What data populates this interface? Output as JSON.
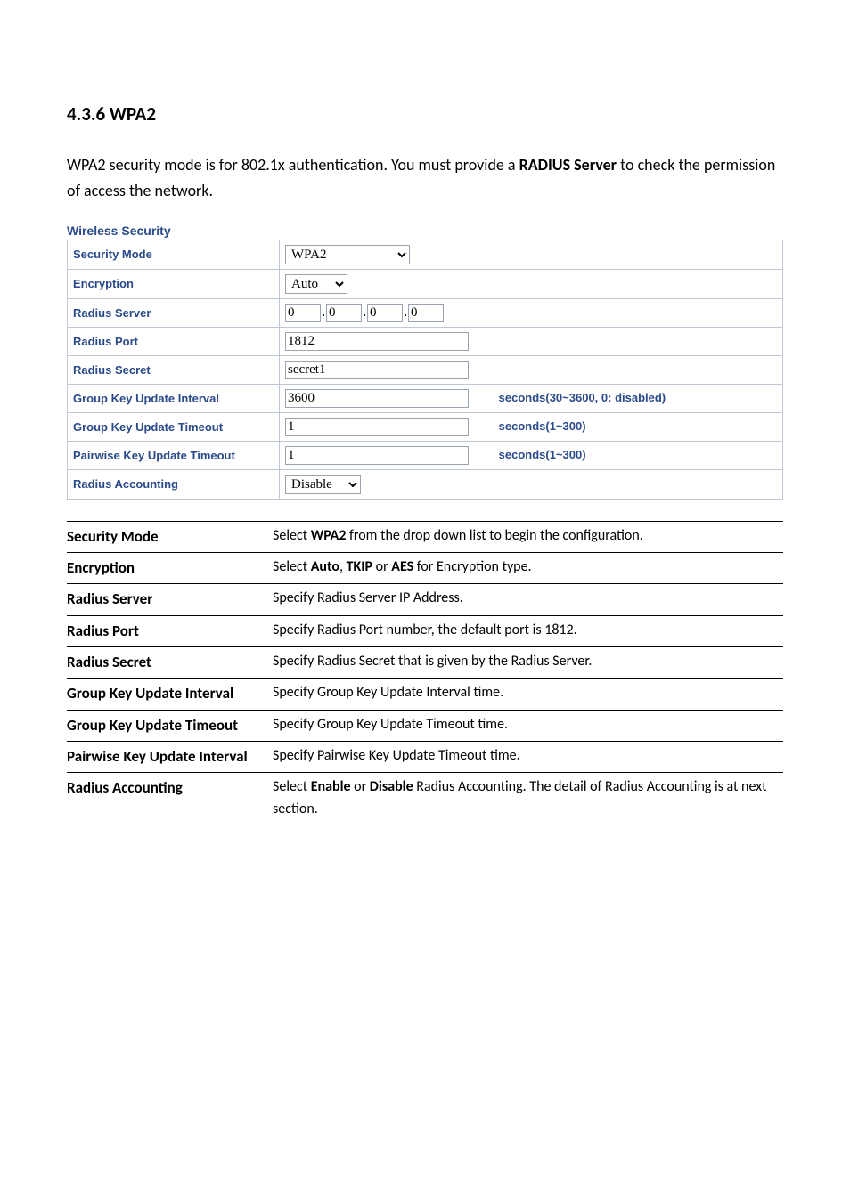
{
  "heading": "4.3.6 WPA2",
  "intro_parts": {
    "p1": "WPA2 security mode is for 802.1x authentication. You must provide a ",
    "p1_bold": "RADIUS Server",
    "p2": " to check the permission of access the network."
  },
  "section_title": "Wireless Security",
  "form": {
    "labels": {
      "security_mode": "Security Mode",
      "encryption": "Encryption",
      "radius_server": "Radius Server",
      "radius_port": "Radius Port",
      "radius_secret": "Radius Secret",
      "group_key_update_interval": "Group Key Update Interval",
      "group_key_update_timeout": "Group Key Update Timeout",
      "pairwise_key_update_timeout": "Pairwise Key Update Timeout",
      "radius_accounting": "Radius Accounting"
    },
    "values": {
      "security_mode": "WPA2",
      "encryption": "Auto",
      "ip": {
        "a": "0",
        "b": "0",
        "c": "0",
        "d": "0"
      },
      "radius_port": "1812",
      "radius_secret": "secret1",
      "group_key_update_interval": "3600",
      "group_key_update_timeout": "1",
      "pairwise_key_update_timeout": "1",
      "radius_accounting": "Disable"
    },
    "hints": {
      "group_key_update_interval": "seconds(30~3600, 0: disabled)",
      "group_key_update_timeout": "seconds(1~300)",
      "pairwise_key_update_timeout": "seconds(1~300)"
    }
  },
  "desc": {
    "rows": [
      {
        "term": "Security Mode",
        "parts": [
          "Select ",
          "WPA2",
          " from the drop down list to begin the configuration."
        ]
      },
      {
        "term": "Encryption",
        "parts": [
          "Select ",
          "Auto",
          ", ",
          "TKIP",
          " or ",
          "AES",
          " for Encryption type."
        ]
      },
      {
        "term": "Radius Server",
        "parts": [
          "Specify Radius Server IP Address."
        ]
      },
      {
        "term": "Radius Port",
        "parts": [
          "Specify Radius Port number, the default port is 1812."
        ]
      },
      {
        "term": "Radius Secret",
        "parts": [
          "Specify Radius Secret that is given by the Radius Server."
        ]
      },
      {
        "term": "Group Key Update Interval",
        "parts": [
          "Specify Group Key Update Interval time."
        ]
      },
      {
        "term": "Group Key Update Timeout",
        "parts": [
          "Specify Group Key Update Timeout time."
        ]
      },
      {
        "term": "Pairwise Key Update Interval",
        "parts": [
          "Specify Pairwise Key Update Timeout time."
        ]
      },
      {
        "term": "Radius Accounting",
        "parts": [
          "Select ",
          "Enable",
          " or ",
          "Disable",
          " Radius Accounting. The detail of Radius Accounting is at next section."
        ]
      }
    ]
  }
}
